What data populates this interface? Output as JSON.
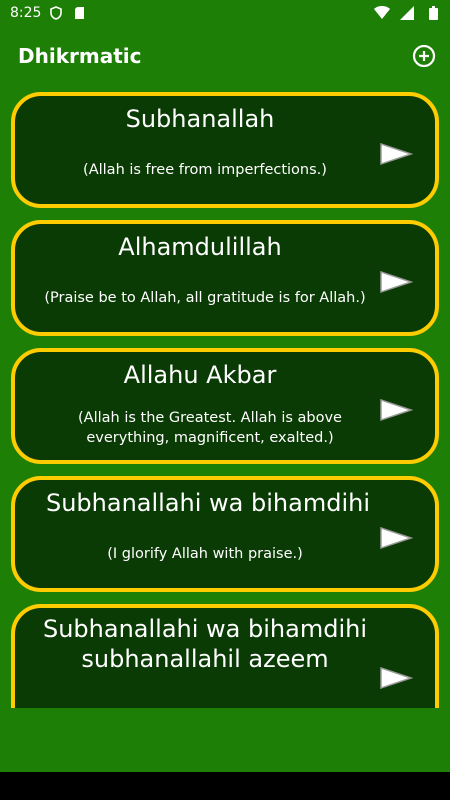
{
  "status_bar": {
    "time": "8:25",
    "left_icons": [
      "shield-icon",
      "sd-card-icon"
    ],
    "right_icons": [
      "wifi-icon",
      "signal-icon",
      "battery-icon"
    ]
  },
  "app_bar": {
    "title": "Dhikrmatic",
    "add_icon": "plus-circle-icon"
  },
  "colors": {
    "app_bar": "#1e7f07",
    "background": "#1e7f07",
    "card_fill": "#0b3b05",
    "card_border": "#ffcc00",
    "text": "#ffffff"
  },
  "dhikr_list": [
    {
      "title": "Subhanallah",
      "translation": "(Allah is free from imperfections.)",
      "action_icon": "play-icon"
    },
    {
      "title": "Alhamdulillah",
      "translation": "(Praise be to Allah, all gratitude is for Allah.)",
      "action_icon": "play-icon"
    },
    {
      "title": "Allahu Akbar",
      "translation": "(Allah is the Greatest. Allah is above everything, magnificent, exalted.)",
      "action_icon": "play-icon"
    },
    {
      "title": "Subhanallahi wa bihamdihi",
      "translation": "(I glorify Allah with praise.)",
      "action_icon": "play-icon"
    },
    {
      "title": "Subhanallahi wa bihamdihi subhanallahil azeem",
      "translation": "",
      "action_icon": "play-icon"
    }
  ]
}
